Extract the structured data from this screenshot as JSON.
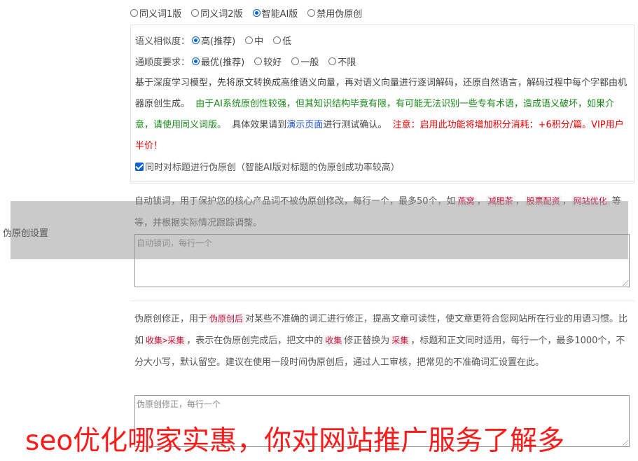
{
  "row_label": "伪原创设置",
  "version_options": [
    {
      "label": "同义词1版",
      "checked": false
    },
    {
      "label": "同义词2版",
      "checked": false
    },
    {
      "label": "智能AI版",
      "checked": true
    },
    {
      "label": "禁用伪原创",
      "checked": false
    }
  ],
  "similarity": {
    "label": "语义相似度：",
    "options": [
      {
        "label": "高(推荐)",
        "checked": true
      },
      {
        "label": "中",
        "checked": false
      },
      {
        "label": "低",
        "checked": false
      }
    ]
  },
  "fluency": {
    "label": "通顺度要求：",
    "options": [
      {
        "label": "最优(推荐)",
        "checked": true
      },
      {
        "label": "较好",
        "checked": false
      },
      {
        "label": "一般",
        "checked": false
      },
      {
        "label": "不限",
        "checked": false
      }
    ]
  },
  "ai_description": {
    "intro": "基于深度学习模型，先将原文转换成高维语义向量，再对语义向量进行逐词解码，还原自然语言，解码过程中每个字都由机器原创生成。",
    "warning_green": "由于AI系统原创性较强，但其知识结构毕竟有限，有可能无法识别一些专有术语，造成语义破坏，如果介意，请使用同义词版。",
    "test_prefix": "具体效果请到",
    "demo_link": "演示页面",
    "test_suffix": "进行测试确认。",
    "note_red": "注意：启用此功能将增加积分消耗：+6积分/篇。VIP用户半价！"
  },
  "title_checkbox": {
    "label": "同时对标题进行伪原创（智能AI版对标题的伪原创成功率较高）",
    "checked": true
  },
  "lock_words": {
    "desc_prefix": "自动锁词，用于保护您的核心产品词不被伪原创修改，每行一个，最多50个，如",
    "examples": [
      "燕窝",
      "减肥茶",
      "股票配资",
      "网站优化"
    ],
    "sep": "，",
    "desc_suffix": "等等，并根据实际情况跟踪调整。",
    "placeholder": "自动锁词，每行一个"
  },
  "correction": {
    "p1": "伪原创修正，用于",
    "tag1": "伪原创后",
    "p2": "对某些不准确的词汇进行修正，提高文章可读性，使文章更符合您网站所在行业的用语习惯。比如",
    "tag2": "收集>采集",
    "p3": "，表示在伪原创完成后，把文中的",
    "tag3": "收集",
    "p4": "修正替换为",
    "tag4": "采集",
    "p5": "，标题和正文同时适用，每行一个，最多1000个，不分大小写，默认留空。建议在使用一段时间伪原创后，通过人工审核，把常见的不准确词汇设置在此。",
    "placeholder": "伪原创修正，每行一个"
  },
  "banner": "seo优化哪家实惠，你对网站推广服务了解多"
}
